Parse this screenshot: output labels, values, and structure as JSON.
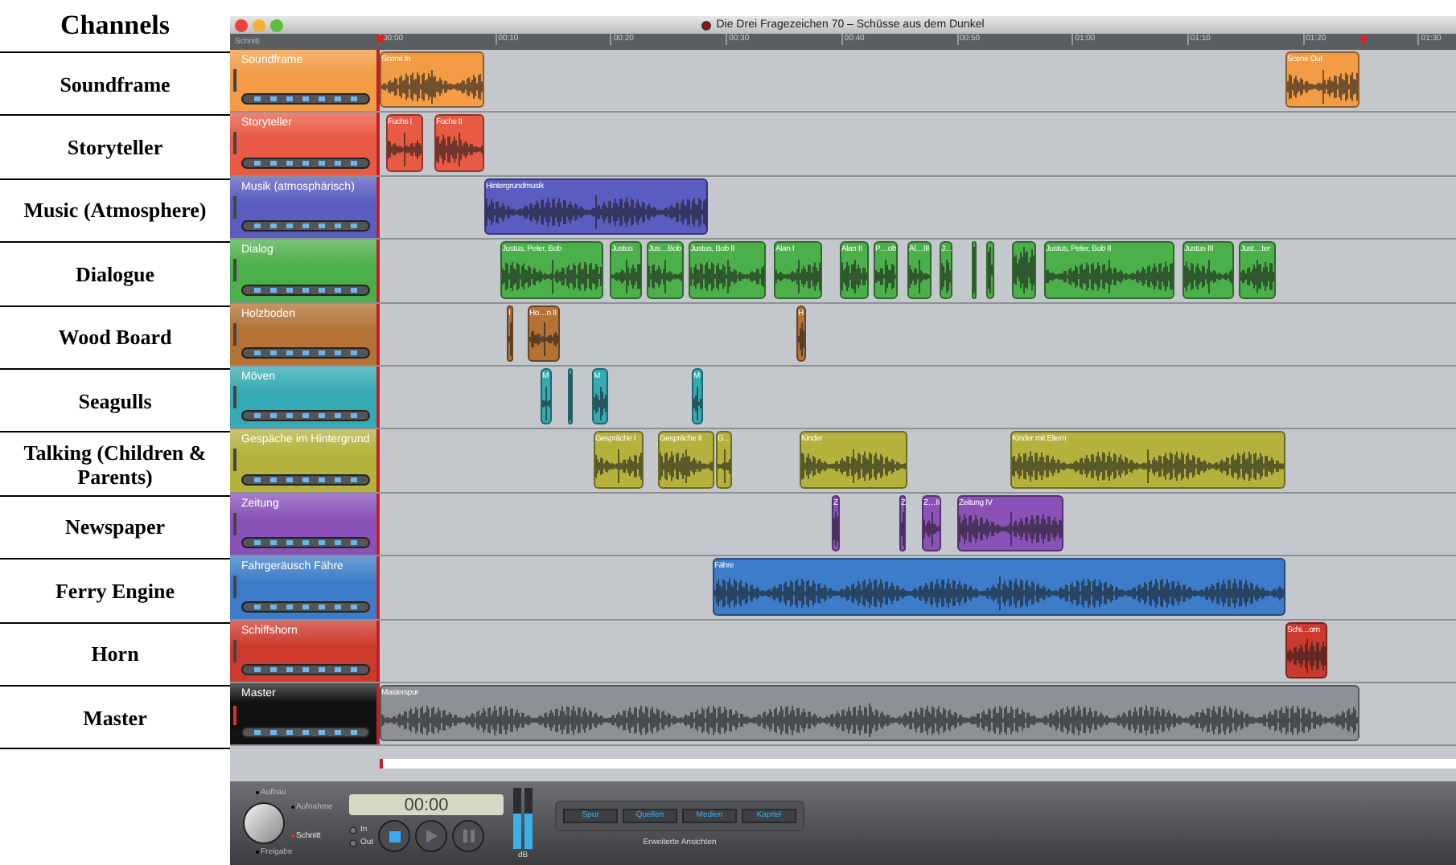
{
  "heading": "Channels",
  "window": {
    "title": "Die Drei Fragezeichen 70 – Schüsse aus dem Dunkel"
  },
  "ruler": {
    "mode": "Schnitt",
    "ticks": [
      "00:00",
      "00:10",
      "00:20",
      "00:30",
      "00:40",
      "00:50",
      "01:00",
      "01:10",
      "01:20",
      "01:30"
    ]
  },
  "channels": [
    {
      "label": "Soundframe",
      "track": {
        "kind": "track",
        "name": "Soundframe",
        "color": "#f39c45",
        "clips": [
          {
            "label": "Scene In"
          },
          {
            "label": "Scene Out"
          }
        ]
      }
    },
    {
      "label": "Storyteller",
      "track": {
        "kind": "track",
        "name": "Storyteller",
        "color": "#e95a44",
        "clips": [
          {
            "label": "Fuchs I"
          },
          {
            "label": "Fuchs II"
          }
        ]
      }
    },
    {
      "label": "Music (Atmosphere)",
      "track": {
        "kind": "track",
        "name": "Musik (atmosphärisch)",
        "color": "#5a5cc0",
        "clips": [
          {
            "label": "Hintergrundmusik"
          }
        ]
      }
    },
    {
      "label": "Dialogue",
      "track": {
        "kind": "track",
        "name": "Dialog",
        "color": "#4cb04a",
        "clips": [
          {
            "label": "Justus, Peter, Bob"
          },
          {
            "label": "Justus"
          },
          {
            "label": "Jus…Bob"
          },
          {
            "label": "Justus, Bob II"
          },
          {
            "label": "Alan I"
          },
          {
            "label": "Alan II"
          },
          {
            "label": "P…ob"
          },
          {
            "label": "Al…III"
          },
          {
            "label": "J…"
          },
          {
            "kind": "unlabeled"
          },
          {
            "kind": "unlabeled"
          },
          {
            "kind": "unlabeled"
          },
          {
            "label": "Justus, Peter, Bob II"
          },
          {
            "label": "Justus III"
          },
          {
            "label": "Just…ter"
          }
        ]
      }
    },
    {
      "label": "Wood Board",
      "track": {
        "kind": "track",
        "name": "Holzboden",
        "color": "#b47236",
        "clips": [
          {
            "label": "I"
          },
          {
            "label": "Ho…n II"
          },
          {
            "label": "H"
          }
        ]
      }
    },
    {
      "label": "Seagulls",
      "track": {
        "kind": "track",
        "name": "Möven",
        "color": "#35aab4",
        "clips": [
          {
            "label": "M"
          },
          {
            "kind": "unlabeled"
          },
          {
            "label": "M"
          },
          {
            "label": "M"
          }
        ]
      }
    },
    {
      "label": "Talking (Children & Parents)",
      "track": {
        "kind": "track",
        "name": "Gespäche im Hintergrund",
        "color": "#b4b23c",
        "clips": [
          {
            "label": "Gespräche I"
          },
          {
            "label": "Gespräche II"
          },
          {
            "label": "G…"
          },
          {
            "label": "Kinder"
          },
          {
            "label": "Kinder mit Eltern"
          }
        ]
      }
    },
    {
      "label": "Newspaper",
      "track": {
        "kind": "track",
        "name": "Zeitung",
        "color": "#8a52b8",
        "clips": [
          {
            "label": "Z"
          },
          {
            "label": "Z"
          },
          {
            "label": "Z…II"
          },
          {
            "label": "Zeitung IV"
          }
        ]
      }
    },
    {
      "label": "Ferry Engine",
      "track": {
        "kind": "track",
        "name": "Fahrgeräusch Fähre",
        "color": "#3c7cc8",
        "clips": [
          {
            "label": "Fähre"
          }
        ]
      }
    },
    {
      "label": "Horn",
      "track": {
        "kind": "track",
        "name": "Schiffshorn",
        "color": "#cc3a2e",
        "clips": [
          {
            "label": "Schi…orn"
          }
        ]
      }
    },
    {
      "label": "Master",
      "track": {
        "kind": "master",
        "name": "Master",
        "color": "#111111",
        "clips": [
          {
            "label": "Masterspur"
          }
        ]
      }
    }
  ],
  "toolbar": {
    "modes": [
      {
        "label": "Aufbau",
        "selected": false
      },
      {
        "label": "Aufnahme",
        "selected": false
      },
      {
        "label": "Schnitt",
        "selected": true
      },
      {
        "label": "Freigabe",
        "selected": false
      }
    ],
    "time": "00:00",
    "markers": [
      {
        "label": "In"
      },
      {
        "label": "Out"
      }
    ],
    "meter_label": "dB",
    "views": [
      {
        "label": "Spur"
      },
      {
        "label": "Quellen"
      },
      {
        "label": "Medien"
      },
      {
        "label": "Kapitel"
      }
    ],
    "views_caption": "Erweiterte Ansichten"
  }
}
